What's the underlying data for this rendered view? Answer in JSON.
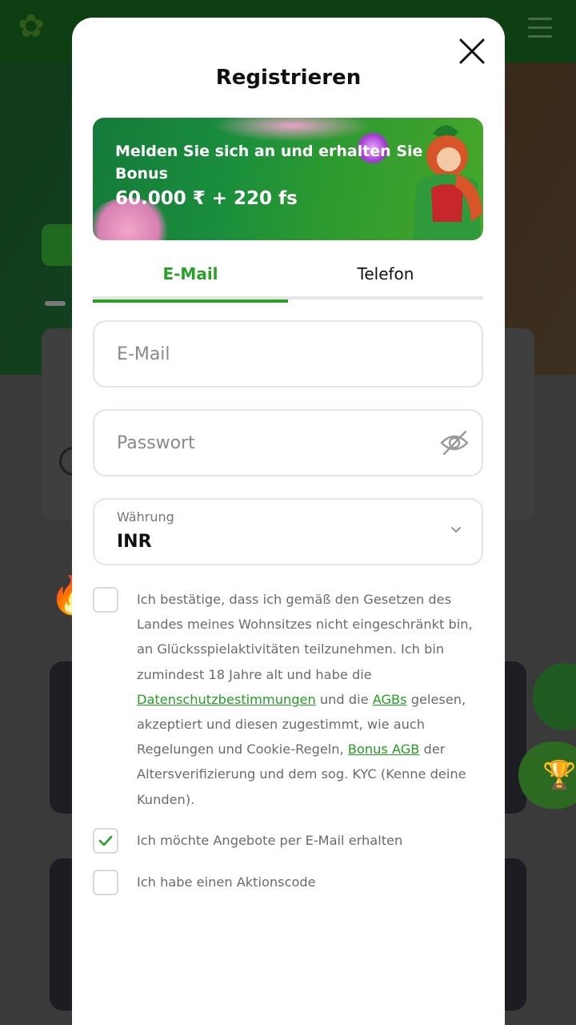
{
  "modal": {
    "title": "Registrieren",
    "close_icon": "close-icon"
  },
  "promo": {
    "text": "Melden Sie sich an und erhalten Sie Bonus",
    "amount": "60.000 ₹ + 220 fs"
  },
  "tabs": [
    {
      "label": "E-Mail",
      "active": true
    },
    {
      "label": "Telefon",
      "active": false
    }
  ],
  "form": {
    "email_placeholder": "E-Mail",
    "password_placeholder": "Passwort",
    "password_icon": "eye-off-icon",
    "currency_label": "Währung",
    "currency_value": "INR"
  },
  "consent": {
    "text_1": "Ich bestätige, dass ich gemäß den Gesetzen des Landes meines Wohnsitzes nicht eingeschränkt bin, an Glücksspielaktivitäten teilzunehmen. Ich bin zumindest 18 Jahre alt und habe die ",
    "link_privacy": "Datenschutzbestimmungen",
    "text_2": " und die ",
    "link_terms": "AGBs",
    "text_3": " gelesen, akzeptiert und diesen zugestimmt, wie auch Regelungen und Cookie-Regeln, ",
    "link_bonus": "Bonus AGB",
    "text_4": " der Altersverifizierung und dem sog. KYC (Kenne deine Kunden).",
    "checked": false
  },
  "options": {
    "email_offers": {
      "label": "Ich möchte Angebote per E-Mail erhalten",
      "checked": true
    },
    "promo_code": {
      "label": "Ich habe einen Aktionscode",
      "checked": false
    }
  },
  "colors": {
    "accent": "#27a227",
    "header_bg": "#0e3f12"
  }
}
